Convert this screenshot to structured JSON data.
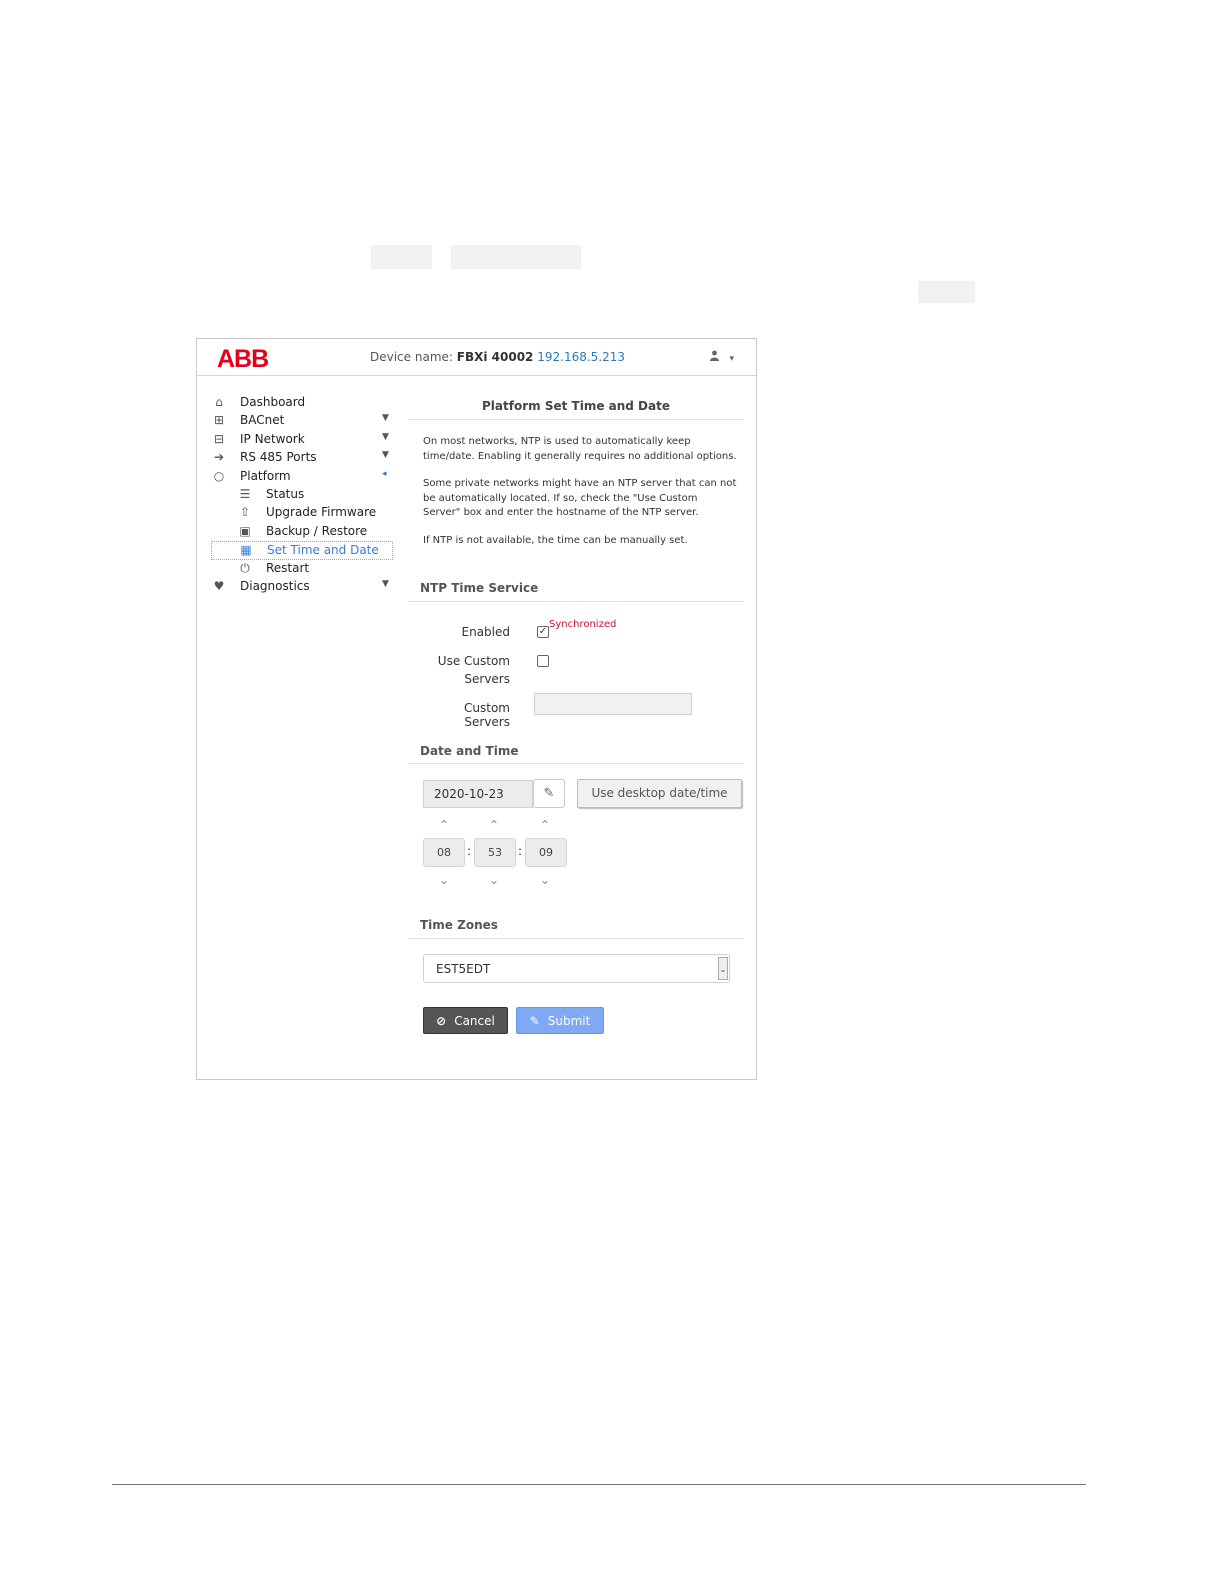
{
  "header": {
    "logo": "ABB",
    "device_label": "Device name:",
    "device_name": "FBXi 40002",
    "device_ip": "192.168.5.213",
    "user_menu_icon": "user-icon",
    "user_menu_caret": "▾"
  },
  "sidebar": {
    "items": [
      {
        "label": "Dashboard",
        "icon": "home-icon"
      },
      {
        "label": "BACnet",
        "icon": "network-icon",
        "arrow": "▼"
      },
      {
        "label": "IP Network",
        "icon": "sitemap-icon",
        "arrow": "▼"
      },
      {
        "label": "RS 485 Ports",
        "icon": "sign-in-icon",
        "arrow": "▼"
      },
      {
        "label": "Platform",
        "icon": "spinner-icon",
        "arrow": "◂"
      },
      {
        "label": "Status",
        "icon": "list-icon"
      },
      {
        "label": "Upgrade Firmware",
        "icon": "upload-icon"
      },
      {
        "label": "Backup / Restore",
        "icon": "floppy-icon"
      },
      {
        "label": "Set Time and Date",
        "icon": "calendar-icon",
        "active": true
      },
      {
        "label": "Restart",
        "icon": "power-icon"
      },
      {
        "label": "Diagnostics",
        "icon": "heartbeat-icon",
        "arrow": "▼"
      }
    ]
  },
  "main": {
    "title": "Platform Set Time and Date",
    "help": [
      "On most networks, NTP is used to automatically keep time/date. Enabling it generally requires no additional options.",
      "Some private networks might have an NTP server that can not be automatically located. If so, check the \"Use Custom Server\" box and enter the hostname of the NTP server.",
      "If NTP is not available, the time can be manually set."
    ],
    "ntp": {
      "heading": "NTP Time Service",
      "enabled_label": "Enabled",
      "enabled_checked": true,
      "status": "Synchronized",
      "custom_label_line1": "Use Custom",
      "custom_label_line2": "Servers",
      "custom_checked": false,
      "servers_label": "Custom Servers",
      "servers_value": ""
    },
    "datetime": {
      "heading": "Date and Time",
      "date": "2020-10-23",
      "desktop_button": "Use desktop date/time",
      "hour": "08",
      "minute": "53",
      "second": "09",
      "separator": ":"
    },
    "timezone": {
      "heading": "Time Zones",
      "value": "EST5EDT"
    },
    "buttons": {
      "cancel": "Cancel",
      "submit": "Submit"
    }
  }
}
